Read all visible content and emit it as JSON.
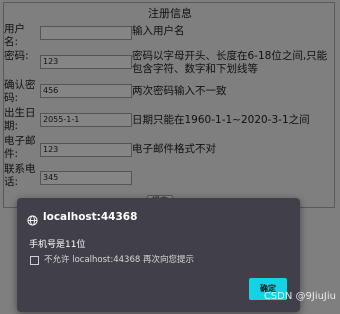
{
  "form": {
    "title": "注册信息",
    "rows": [
      {
        "label": "用户名:",
        "value": "",
        "message": "输入用户名"
      },
      {
        "label": "密码:",
        "value": "123",
        "message": "密码以字母开头、长度在6-18位之间,只能包含字符、数字和下划线等"
      },
      {
        "label": "确认密码:",
        "value": "456",
        "message": "两次密码输入不一致"
      },
      {
        "label": "出生日期:",
        "value": "2055-1-1",
        "message": "日期只能在1960-1-1~2020-3-1之间"
      },
      {
        "label": "电子邮件:",
        "value": "123",
        "message": "电子邮件格式不对"
      },
      {
        "label": "联系电话:",
        "value": "345",
        "message": ""
      }
    ],
    "submit_label": "提交"
  },
  "dialog": {
    "origin": "localhost:44368",
    "message": "手机号是11位",
    "checkbox_label": "不允许 localhost:44368 再次向您提示",
    "ok_label": "确定"
  },
  "watermark": "CSDN @9JiuJiu"
}
